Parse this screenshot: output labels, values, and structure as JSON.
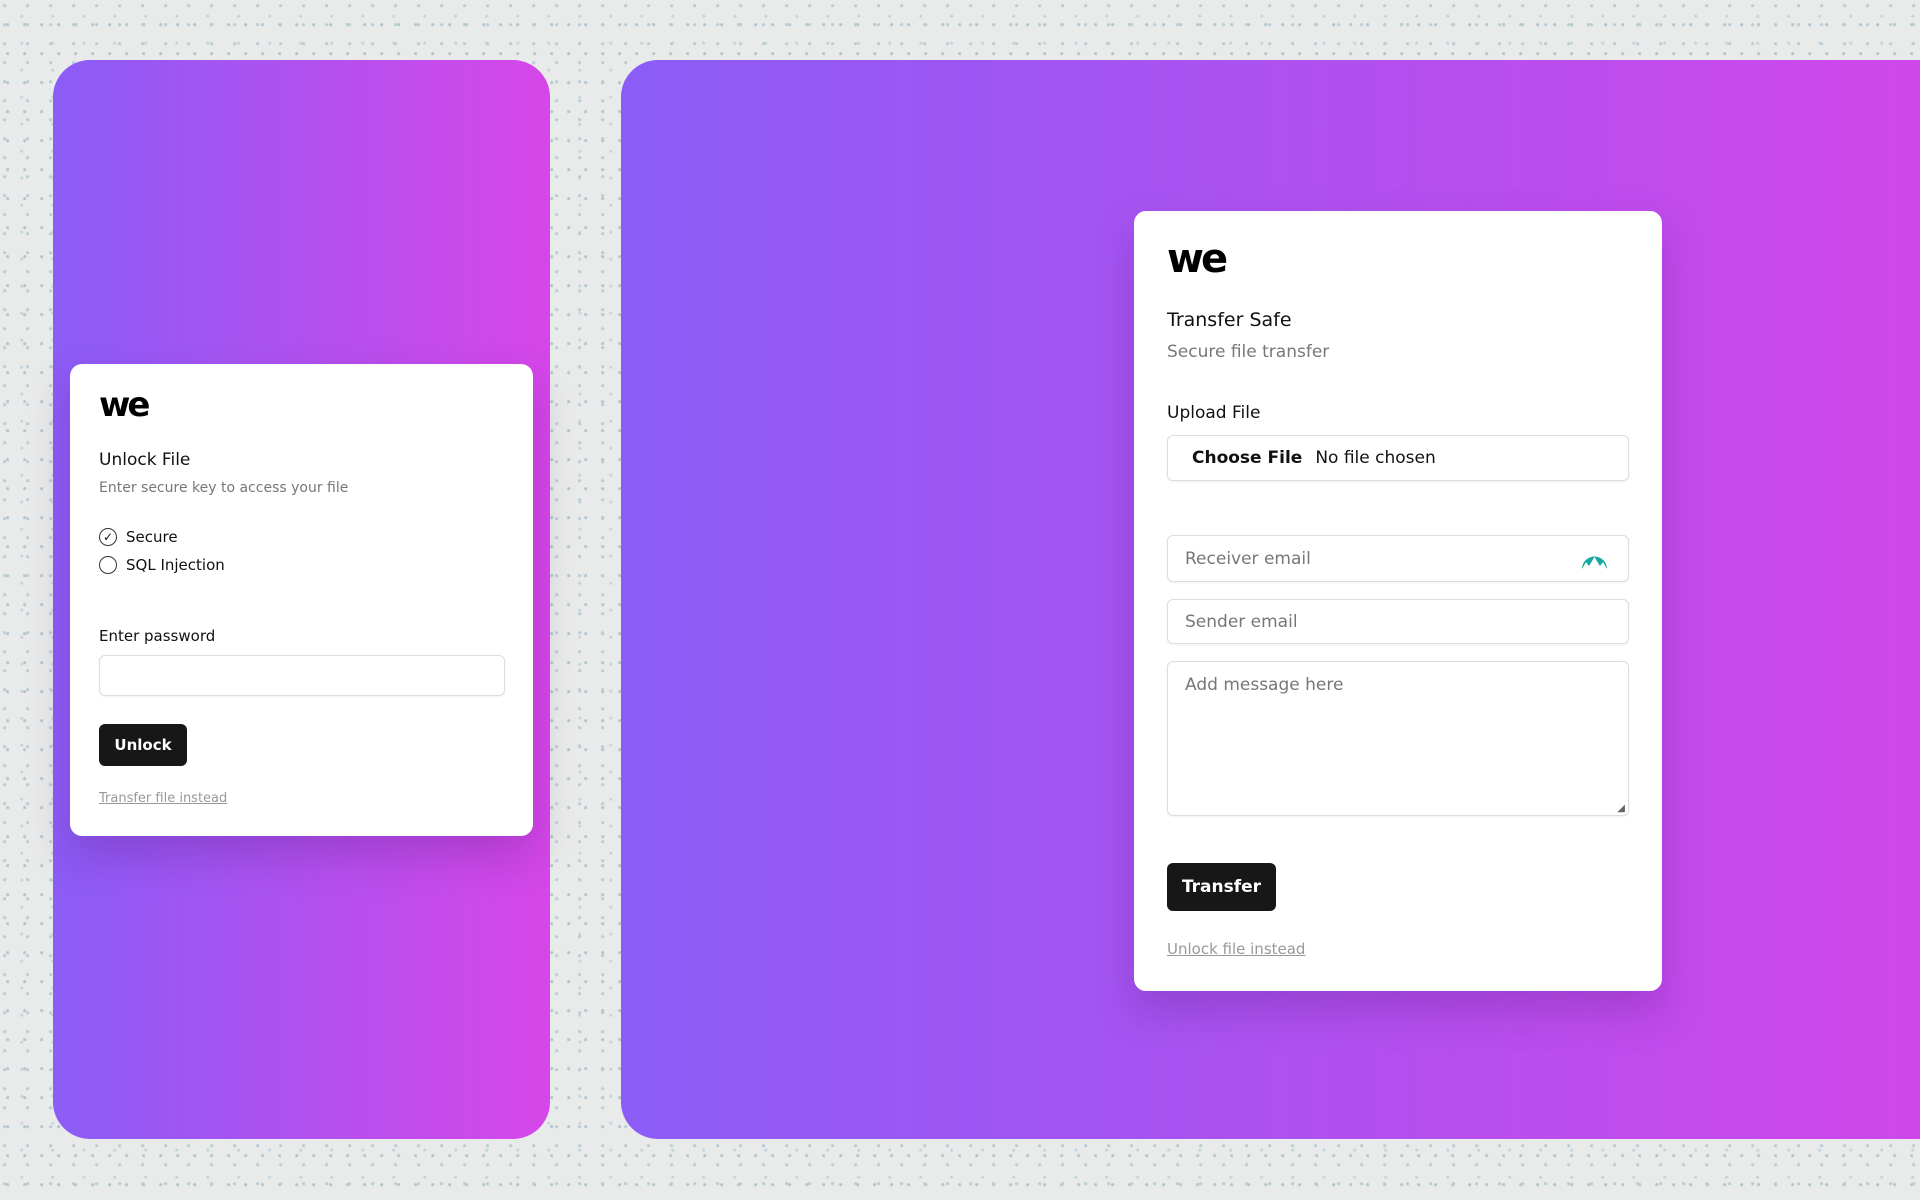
{
  "unlock": {
    "logo": "we",
    "title": "Unlock File",
    "subtitle": "Enter secure key to access your file",
    "options": [
      {
        "label": "Secure",
        "checked": true
      },
      {
        "label": "SQL Injection",
        "checked": false
      }
    ],
    "password_label": "Enter password",
    "password_value": "",
    "button": "Unlock",
    "link": "Transfer file instead"
  },
  "transfer": {
    "logo": "we",
    "title": "Transfer Safe",
    "subtitle": "Secure file transfer",
    "upload_label": "Upload File",
    "choose_file": "Choose File",
    "no_file": "No file chosen",
    "receiver_placeholder": "Receiver email",
    "sender_placeholder": "Sender email",
    "message_placeholder": "Add message here",
    "button": "Transfer",
    "link": "Unlock file instead",
    "extension_icon_color": "#14a8a0"
  }
}
